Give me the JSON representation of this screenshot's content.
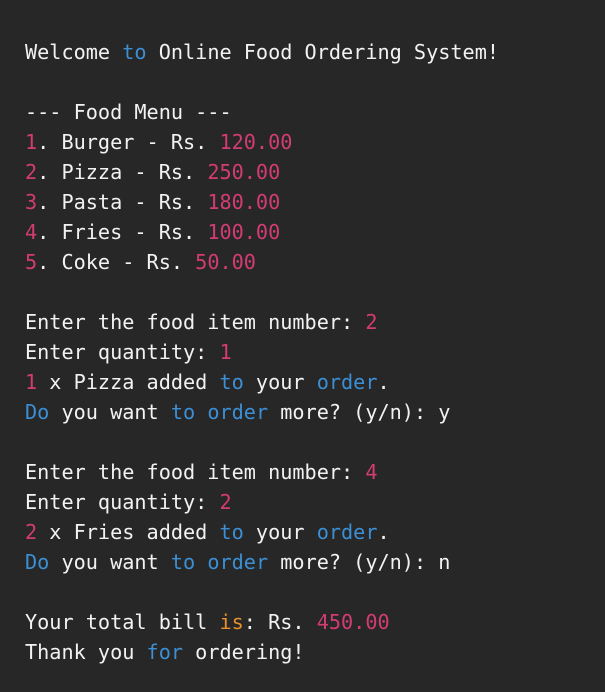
{
  "lines": [
    [
      {
        "t": "Welcome "
      },
      {
        "t": "to",
        "c": "kw"
      },
      {
        "t": " Online Food Ordering System!"
      }
    ],
    [],
    [
      {
        "t": "--- Food Menu ---"
      }
    ],
    [
      {
        "t": "1",
        "c": "num"
      },
      {
        "t": ". Burger - Rs. "
      },
      {
        "t": "120.00",
        "c": "num"
      }
    ],
    [
      {
        "t": "2",
        "c": "num"
      },
      {
        "t": ". Pizza - Rs. "
      },
      {
        "t": "250.00",
        "c": "num"
      }
    ],
    [
      {
        "t": "3",
        "c": "num"
      },
      {
        "t": ". Pasta - Rs. "
      },
      {
        "t": "180.00",
        "c": "num"
      }
    ],
    [
      {
        "t": "4",
        "c": "num"
      },
      {
        "t": ". Fries - Rs. "
      },
      {
        "t": "100.00",
        "c": "num"
      }
    ],
    [
      {
        "t": "5",
        "c": "num"
      },
      {
        "t": ". Coke - Rs. "
      },
      {
        "t": "50.00",
        "c": "num"
      }
    ],
    [],
    [
      {
        "t": "Enter the food item number: "
      },
      {
        "t": "2",
        "c": "num"
      }
    ],
    [
      {
        "t": "Enter quantity: "
      },
      {
        "t": "1",
        "c": "num"
      }
    ],
    [
      {
        "t": "1",
        "c": "num"
      },
      {
        "t": " x Pizza added "
      },
      {
        "t": "to",
        "c": "kw"
      },
      {
        "t": " your "
      },
      {
        "t": "order",
        "c": "kw"
      },
      {
        "t": "."
      }
    ],
    [
      {
        "t": "Do",
        "c": "kw"
      },
      {
        "t": " you want "
      },
      {
        "t": "to",
        "c": "kw"
      },
      {
        "t": " "
      },
      {
        "t": "order",
        "c": "kw"
      },
      {
        "t": " more? (y/n): y"
      }
    ],
    [],
    [
      {
        "t": "Enter the food item number: "
      },
      {
        "t": "4",
        "c": "num"
      }
    ],
    [
      {
        "t": "Enter quantity: "
      },
      {
        "t": "2",
        "c": "num"
      }
    ],
    [
      {
        "t": "2",
        "c": "num"
      },
      {
        "t": " x Fries added "
      },
      {
        "t": "to",
        "c": "kw"
      },
      {
        "t": " your "
      },
      {
        "t": "order",
        "c": "kw"
      },
      {
        "t": "."
      }
    ],
    [
      {
        "t": "Do",
        "c": "kw"
      },
      {
        "t": " you want "
      },
      {
        "t": "to",
        "c": "kw"
      },
      {
        "t": " "
      },
      {
        "t": "order",
        "c": "kw"
      },
      {
        "t": " more? (y/n): n"
      }
    ],
    [],
    [
      {
        "t": "Your total bill "
      },
      {
        "t": "is",
        "c": "op"
      },
      {
        "t": ": Rs. "
      },
      {
        "t": "450.00",
        "c": "num"
      }
    ],
    [
      {
        "t": "Thank you "
      },
      {
        "t": "for",
        "c": "kw"
      },
      {
        "t": " ordering!"
      }
    ]
  ],
  "colors": {
    "background": "#272727",
    "text": "#f2f2f2",
    "number": "#d33c72",
    "keyword": "#3c8fd4",
    "operator": "#e8912e"
  }
}
